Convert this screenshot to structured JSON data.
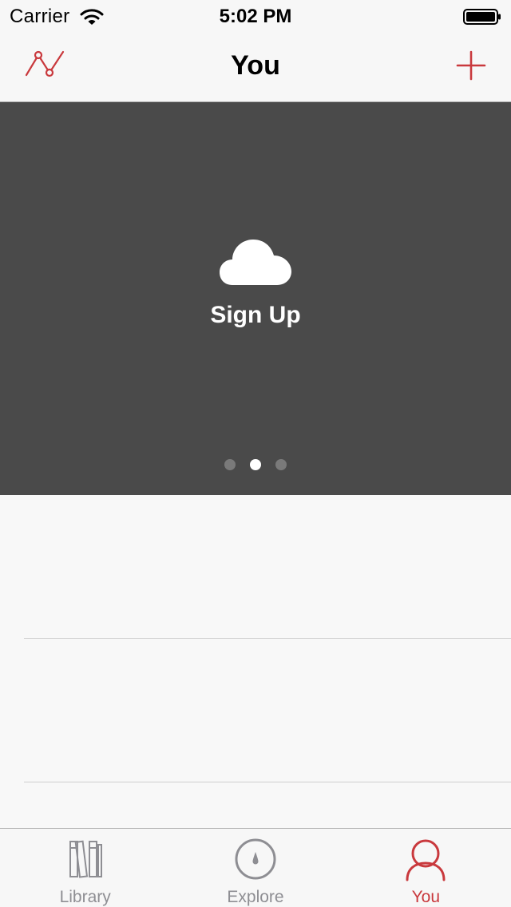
{
  "status_bar": {
    "carrier": "Carrier",
    "time": "5:02 PM",
    "icons": [
      "wifi-icon",
      "battery-icon"
    ]
  },
  "nav": {
    "title": "You",
    "left_icon": "stats-chart-icon",
    "right_icon": "plus-icon"
  },
  "hero": {
    "icon": "cloud-icon",
    "label": "Sign Up",
    "page_count": 3,
    "active_page": 2
  },
  "tabs": [
    {
      "label": "Library",
      "icon": "library-books-icon",
      "active": false
    },
    {
      "label": "Explore",
      "icon": "compass-icon",
      "active": false
    },
    {
      "label": "You",
      "icon": "person-icon",
      "active": true
    }
  ],
  "colors": {
    "accent": "#c9393d",
    "hero_bg": "#4a4a4a",
    "inactive": "#8e8e93",
    "bar_bg": "#f7f7f7"
  }
}
